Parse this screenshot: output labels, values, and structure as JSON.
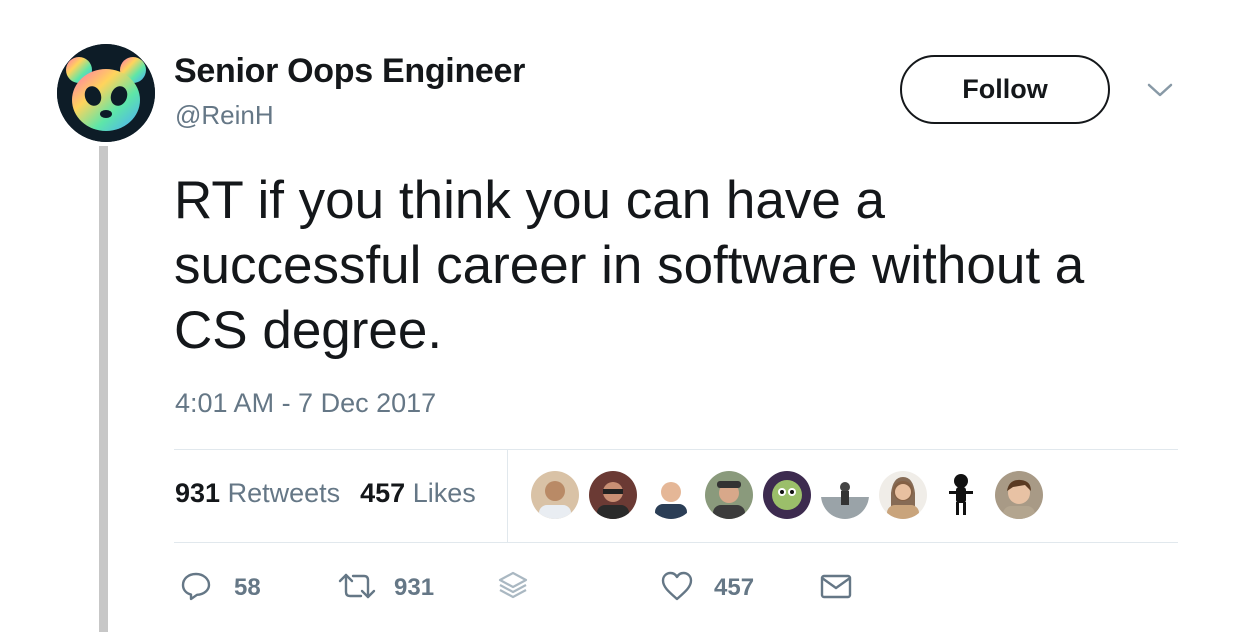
{
  "tweet": {
    "display_name": "Senior Oops Engineer",
    "handle": "@ReinH",
    "text": "RT if you think you can have a\nsuccessful career in software without a\nCS degree.",
    "timestamp": "4:01 AM - 7 Dec 2017"
  },
  "header": {
    "follow_label": "Follow",
    "avatar_icon": "panda-avatar",
    "menu_icon": "chevron-down-icon"
  },
  "stats": {
    "retweets_count": "931",
    "retweets_label": "Retweets",
    "likes_count": "457",
    "likes_label": "Likes"
  },
  "actions": {
    "reply_count": "58",
    "retweet_count": "931",
    "like_count": "457"
  },
  "colors": {
    "text": "#14171a",
    "secondary": "#657786",
    "divider": "#e1e8ed",
    "thread_line": "#c7c7c7"
  }
}
